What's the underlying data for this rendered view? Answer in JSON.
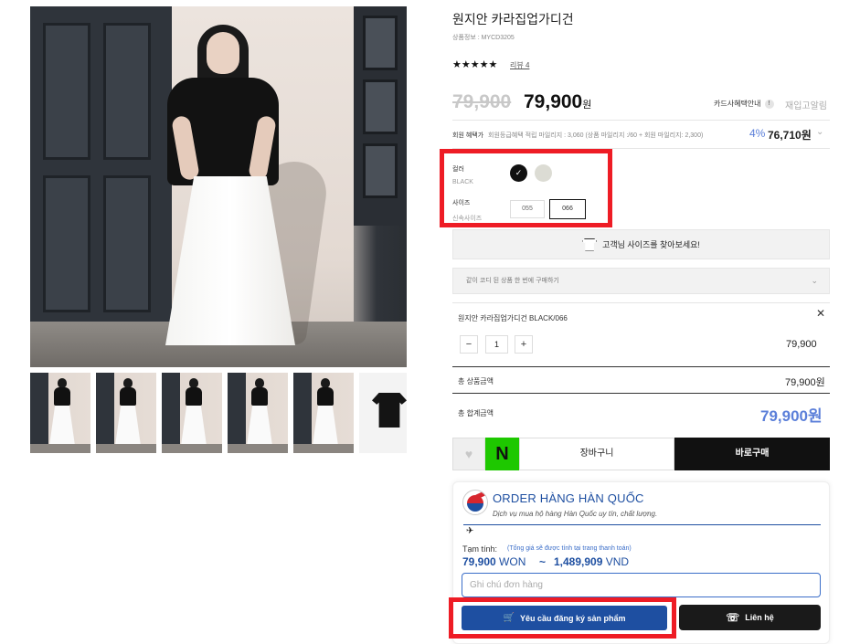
{
  "gallery": {
    "main_image_alt": "model wearing black zip cardigan and white skirt",
    "thumbnail_count": 6
  },
  "product": {
    "title": "원지안 카라집업가디건",
    "code": "상품정보 : MYCD3205",
    "stars": "★★★★★",
    "review_link": "리뷰 4",
    "old_price": "79,900",
    "new_price": "79,900",
    "currency": "원",
    "card_benefit": "카드사혜택안내",
    "restock": "재입고알림"
  },
  "member": {
    "label": "회원 혜택가",
    "detail": "회원등급혜택 적립 마일리지 : 3,060 (상품 마일리지 :/60 + 회원 마일리지: 2,300)",
    "percent": "4%",
    "points": "76,710원",
    "chevron": "⌄"
  },
  "options": {
    "color_label": "컬러",
    "color_value": "BLACK",
    "size_label": "사이즈",
    "size_sub": "신속사이즈",
    "sizes": [
      "055",
      "066"
    ],
    "selected_size": "066",
    "check": "✓"
  },
  "size_finder": "고객님 사이즈를 찾아보세요!",
  "coordi": {
    "label": "같이 코디 된 상품 한 번에 구매하기",
    "chevron": "⌄"
  },
  "selected_item": {
    "name": "원지안 카라집업가디건 BLACK/066",
    "remove": "✕",
    "minus": "−",
    "qty": "1",
    "plus": "+",
    "price": "79,900"
  },
  "summary": {
    "subtotal_label": "총 상품금액",
    "subtotal_value": "79,900원",
    "total_label": "총 합계금액",
    "total_value": "79,900원"
  },
  "actions": {
    "heart": "♥",
    "naver": "N",
    "cart": "장바구니",
    "buy": "바로구매"
  },
  "order_widget": {
    "title": "ORDER HÀNG HÀN QUỐC",
    "subtitle": "Dịch vụ mua hộ hàng Hàn Quốc uy tín, chất lượng.",
    "plane": "✈",
    "tam_label": "Tạm tính:",
    "tam_note": "(Tổng giá sẽ được tính tại trang thanh toán)",
    "won_amount": "79,900",
    "won_unit": "WON",
    "tilde": "~",
    "vnd_amount": "1,489,909",
    "vnd_unit": "VND",
    "note_placeholder": "Ghi chú đơn hàng",
    "request_button": "Yêu cầu đăng ký sản phẩm",
    "cart_icon": "🛒",
    "contact_button": "Liên hệ",
    "phone_icon": "☏"
  },
  "colors": {
    "accent_blue": "#1e4fa1",
    "price_blue": "#5b7fd9",
    "highlight_red": "#ee1c25",
    "naver_green": "#1ec800"
  }
}
